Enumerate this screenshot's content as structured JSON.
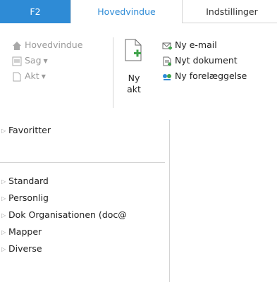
{
  "tabs": {
    "f2": "F2",
    "main": "Hovedvindue",
    "settings": "Indstillinger"
  },
  "ribbon": {
    "left": {
      "home": "Hovedvindue",
      "case": "Sag",
      "doc": "Akt"
    },
    "new_act": "Ny akt",
    "right": {
      "email": "Ny e-mail",
      "document": "Nyt dokument",
      "submission": "Ny forelæggelse"
    }
  },
  "sidebar": {
    "favorites": "Favoritter",
    "items": [
      "Standard",
      "Personlig",
      "Dok Organisationen (doc@",
      "Mapper",
      "Diverse"
    ]
  },
  "colors": {
    "accent": "#2e8bd6",
    "green": "#3fa34a"
  }
}
